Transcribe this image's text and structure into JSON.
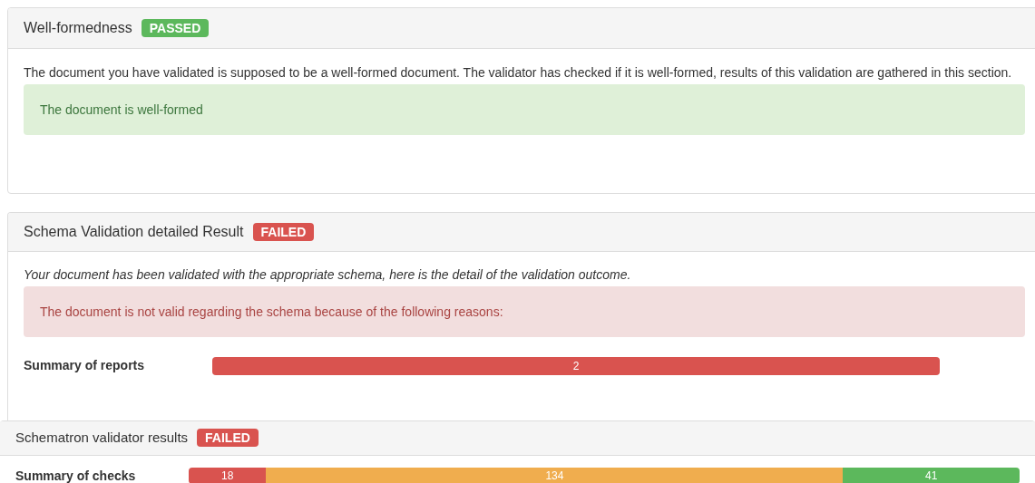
{
  "sections": [
    {
      "title": "Well-formedness",
      "status": {
        "kind": "passed",
        "label": "PASSED"
      },
      "description": "The document you have validated is supposed to be a well-formed document. The validator has checked if it is well-formed, results of this validation are gathered in this section.",
      "description_italic": false,
      "alert": {
        "kind": "success",
        "text": "The document is well-formed"
      }
    },
    {
      "title": "Schema Validation detailed Result",
      "status": {
        "kind": "failed",
        "label": "FAILED"
      },
      "description": "Your document has been validated with the appropriate schema, here is the detail of the validation outcome.",
      "description_italic": true,
      "alert": {
        "kind": "danger",
        "text": "The document is not valid regarding the schema because of the following reasons:"
      },
      "summary": {
        "label": "Summary of reports",
        "segments": [
          {
            "value": "2",
            "color": "#d9534f"
          }
        ]
      }
    },
    {
      "title": "Schematron validator results",
      "status": {
        "kind": "failed",
        "label": "FAILED"
      },
      "summary": {
        "label": "Summary of checks",
        "segments": [
          {
            "value": "18",
            "color": "#d9534f"
          },
          {
            "value": "134",
            "color": "#f0ad4e"
          },
          {
            "value": "41",
            "color": "#5cb85c"
          }
        ]
      }
    }
  ]
}
